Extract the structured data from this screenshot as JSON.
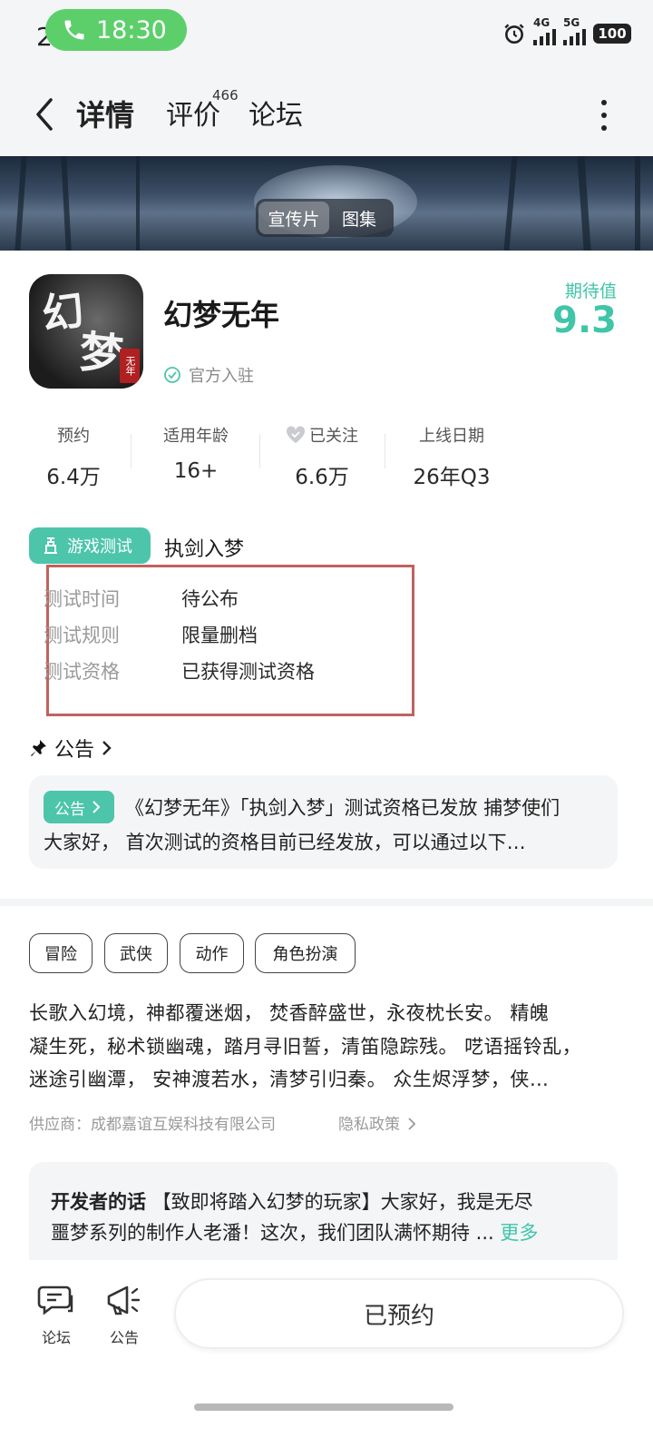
{
  "status_bar": {
    "time_digit": "2",
    "call_time": "18:30",
    "net1": "4G",
    "net2": "5G",
    "battery": "100"
  },
  "nav": {
    "tabs": [
      {
        "label": "详情",
        "active": true
      },
      {
        "label": "评价",
        "badge": "466"
      },
      {
        "label": "论坛"
      }
    ]
  },
  "banner": {
    "media_tabs": [
      "宣传片",
      "图集"
    ]
  },
  "game": {
    "title": "幻梦无年",
    "icon_chars": [
      "幻",
      "梦"
    ],
    "icon_seal": "无年",
    "verified": "官方入驻",
    "expect_label": "期待值",
    "expect_value": "9.3"
  },
  "stats": [
    {
      "label": "预约",
      "value": "6.4万"
    },
    {
      "label": "适用年龄",
      "value": "16+"
    },
    {
      "label": "已关注",
      "value": "6.6万"
    },
    {
      "label": "上线日期",
      "value": "26年Q3"
    }
  ],
  "test": {
    "badge": "游戏测试",
    "name": "执剑入梦",
    "rows": [
      {
        "key": "测试时间",
        "value": "待公布"
      },
      {
        "key": "测试规则",
        "value": "限量删档"
      },
      {
        "key": "测试资格",
        "value": "已获得测试资格"
      }
    ]
  },
  "announcement": {
    "heading": "公告",
    "tag": "公告",
    "line1": "《幻梦无年》「执剑入梦」测试资格已发放 捕梦使们",
    "line2": "大家好， 首次测试的资格目前已经发放，可以通过以下…"
  },
  "tags": [
    "冒险",
    "武侠",
    "动作",
    "角色扮演"
  ],
  "description": [
    "长歌入幻境，神都覆迷烟， 焚香醉盛世，永夜枕长安。 精魄",
    "凝生死，秘术锁幽魂，踏月寻旧誓，清笛隐踪残。 呓语摇铃乱，",
    "迷途引幽潭， 安神渡若水，清梦引归秦。 众生烬浮梦，侠…"
  ],
  "supplier": "供应商：成都嘉谊互娱科技有限公司",
  "privacy": "隐私政策",
  "developer": {
    "title": "开发者的话",
    "line1_rest": "【致即将踏入幻梦的玩家】大家好，我是无尽",
    "line2": "噩梦系列的制作人老潘！这次，我们团队满怀期待 ...",
    "more": "更多"
  },
  "bottom_bar": {
    "forum": "论坛",
    "notice": "公告",
    "button": "已预约"
  }
}
